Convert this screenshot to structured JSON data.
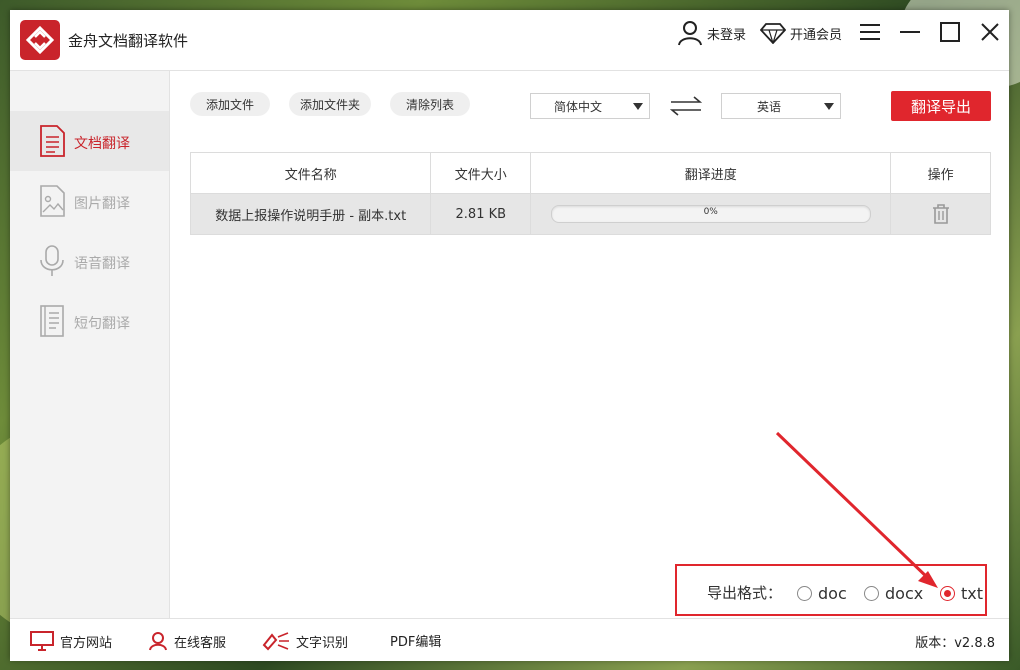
{
  "app": {
    "title": "金舟文档翻译软件"
  },
  "header": {
    "login_label": "未登录",
    "vip_label": "开通会员"
  },
  "sidebar": {
    "items": [
      {
        "label": "文档翻译",
        "active": true,
        "icon": "document-icon"
      },
      {
        "label": "图片翻译",
        "active": false,
        "icon": "image-icon"
      },
      {
        "label": "语音翻译",
        "active": false,
        "icon": "microphone-icon"
      },
      {
        "label": "短句翻译",
        "active": false,
        "icon": "text-page-icon"
      }
    ]
  },
  "toolbar": {
    "add_file": "添加文件",
    "add_folder": "添加文件夹",
    "clear_list": "清除列表",
    "source_lang": "简体中文",
    "target_lang": "英语",
    "export_label": "翻译导出"
  },
  "table": {
    "headers": [
      "文件名称",
      "文件大小",
      "翻译进度",
      "操作"
    ],
    "rows": [
      {
        "name": "数据上报操作说明手册 - 副本.txt",
        "size": "2.81 KB",
        "progress": 0,
        "progress_label": "0%",
        "action_icon": "trash-icon"
      }
    ]
  },
  "export_format": {
    "label": "导出格式：",
    "options": [
      "doc",
      "docx",
      "txt"
    ],
    "selected": "txt"
  },
  "footer": {
    "website": "官方网站",
    "service": "在线客服",
    "ocr": "文字识别",
    "pdf": "PDF编辑",
    "version": "版本：v2.8.8"
  },
  "colors": {
    "accent": "#e0262d",
    "brand": "#c9242b"
  }
}
